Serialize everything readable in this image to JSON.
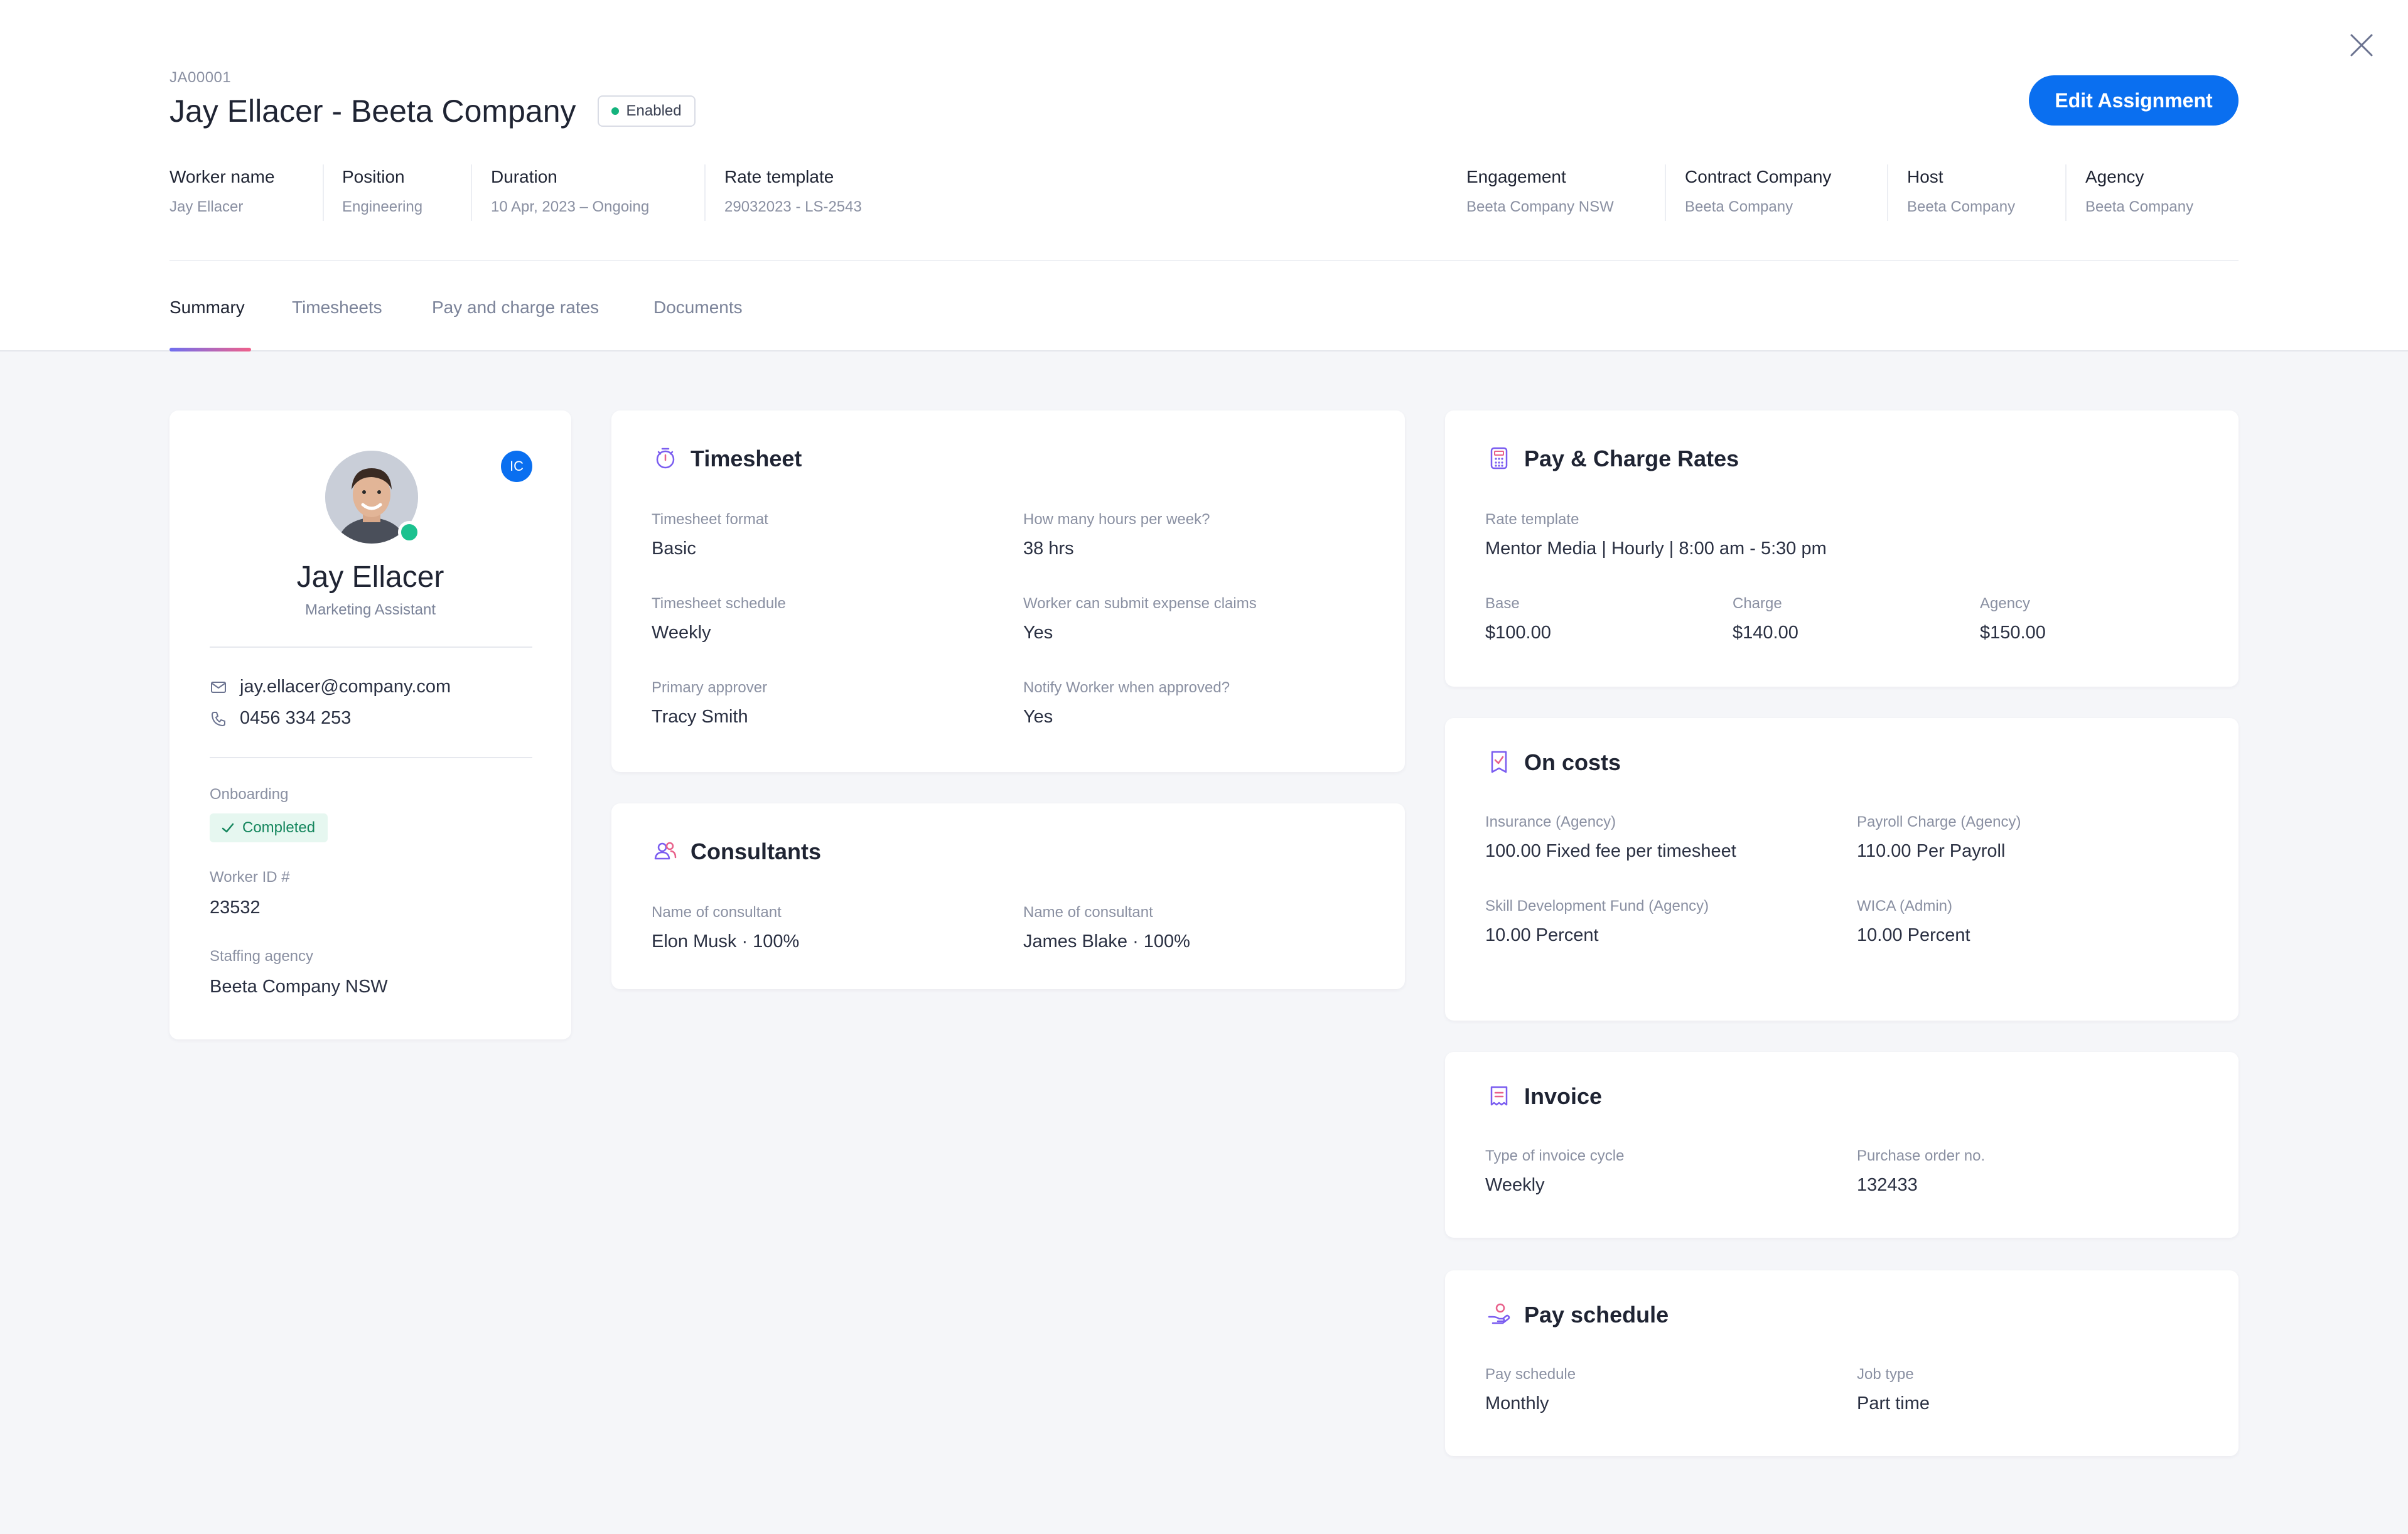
{
  "header": {
    "assignment_id": "JA00001",
    "title": "Jay Ellacer - Beeta Company",
    "status": "Enabled",
    "edit_button": "Edit Assignment",
    "meta": [
      {
        "key": "Worker name",
        "value": "Jay Ellacer"
      },
      {
        "key": "Position",
        "value": "Engineering"
      },
      {
        "key": "Duration",
        "value": "10 Apr, 2023 – Ongoing"
      },
      {
        "key": "Rate template",
        "value": "29032023 - LS-2543"
      },
      {
        "key": "Engagement",
        "value": "Beeta Company NSW"
      },
      {
        "key": "Contract Company",
        "value": "Beeta Company"
      },
      {
        "key": "Host",
        "value": "Beeta Company"
      },
      {
        "key": "Agency",
        "value": "Beeta Company"
      }
    ]
  },
  "tabs": [
    {
      "label": "Summary",
      "active": true
    },
    {
      "label": "Timesheets",
      "active": false
    },
    {
      "label": "Pay and charge rates",
      "active": false
    },
    {
      "label": "Documents",
      "active": false
    }
  ],
  "profile": {
    "name": "Jay Ellacer",
    "role": "Marketing Assistant",
    "badge": "IC",
    "email": "jay.ellacer@company.com",
    "phone": "0456 334 253",
    "onboarding_label": "Onboarding",
    "onboarding_status": "Completed",
    "worker_id_label": "Worker ID #",
    "worker_id": "23532",
    "agency_label": "Staffing agency",
    "agency": "Beeta Company NSW"
  },
  "timesheet": {
    "title": "Timesheet",
    "fields": [
      {
        "label": "Timesheet format",
        "value": "Basic"
      },
      {
        "label": "How many hours per week?",
        "value": "38 hrs"
      },
      {
        "label": "Timesheet schedule",
        "value": "Weekly"
      },
      {
        "label": "Worker can submit expense claims",
        "value": "Yes"
      },
      {
        "label": "Primary approver",
        "value": "Tracy Smith"
      },
      {
        "label": "Notify Worker when approved?",
        "value": "Yes"
      }
    ]
  },
  "consultants": {
    "title": "Consultants",
    "fields": [
      {
        "label": "Name of consultant",
        "value": "Elon Musk · 100%"
      },
      {
        "label": "Name of consultant",
        "value": "James Blake · 100%"
      }
    ]
  },
  "pay_rates": {
    "title": "Pay & Charge Rates",
    "template_label": "Rate template",
    "template_value": "Mentor Media | Hourly | 8:00 am - 5:30 pm",
    "fields": [
      {
        "label": "Base",
        "value": "$100.00"
      },
      {
        "label": "Charge",
        "value": "$140.00"
      },
      {
        "label": "Agency",
        "value": "$150.00"
      }
    ]
  },
  "on_costs": {
    "title": "On costs",
    "fields": [
      {
        "label": "Insurance (Agency)",
        "value": "100.00 Fixed fee per timesheet"
      },
      {
        "label": "Payroll Charge (Agency)",
        "value": "110.00 Per Payroll"
      },
      {
        "label": "Skill Development Fund (Agency)",
        "value": "10.00 Percent"
      },
      {
        "label": "WICA (Admin)",
        "value": "10.00 Percent"
      }
    ]
  },
  "invoice": {
    "title": "Invoice",
    "fields": [
      {
        "label": "Type of invoice cycle",
        "value": "Weekly"
      },
      {
        "label": "Purchase order no.",
        "value": "132433"
      }
    ]
  },
  "pay_schedule": {
    "title": "Pay schedule",
    "fields": [
      {
        "label": "Pay schedule",
        "value": "Monthly"
      },
      {
        "label": "Job type",
        "value": "Part time"
      }
    ]
  },
  "colors": {
    "accent": "#0a6ff0",
    "success": "#14b37d",
    "icon": "#7a5cf0"
  }
}
